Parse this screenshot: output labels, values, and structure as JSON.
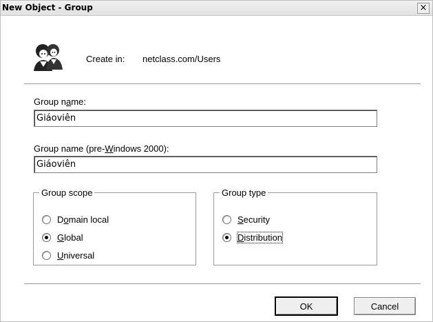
{
  "window": {
    "title": "New Object - Group",
    "close_label": "×"
  },
  "header": {
    "icon": "group-users-icon",
    "create_in_label": "Create in:",
    "create_in_value": "netclass.com/Users"
  },
  "form": {
    "group_name_label": "Group name:",
    "group_name_value": "Giáoviên",
    "group_name_pre2000_label": "Group name (pre-Windows 2000):",
    "group_name_pre2000_value": "Giáoviên"
  },
  "group_scope": {
    "legend": "Group scope",
    "options": [
      {
        "label": "Domain local",
        "checked": false
      },
      {
        "label": "Global",
        "checked": true
      },
      {
        "label": "Universal",
        "checked": false
      }
    ]
  },
  "group_type": {
    "legend": "Group type",
    "options": [
      {
        "label": "Security",
        "checked": false
      },
      {
        "label": "Distribution",
        "checked": true
      }
    ]
  },
  "buttons": {
    "ok": "OK",
    "cancel": "Cancel"
  }
}
